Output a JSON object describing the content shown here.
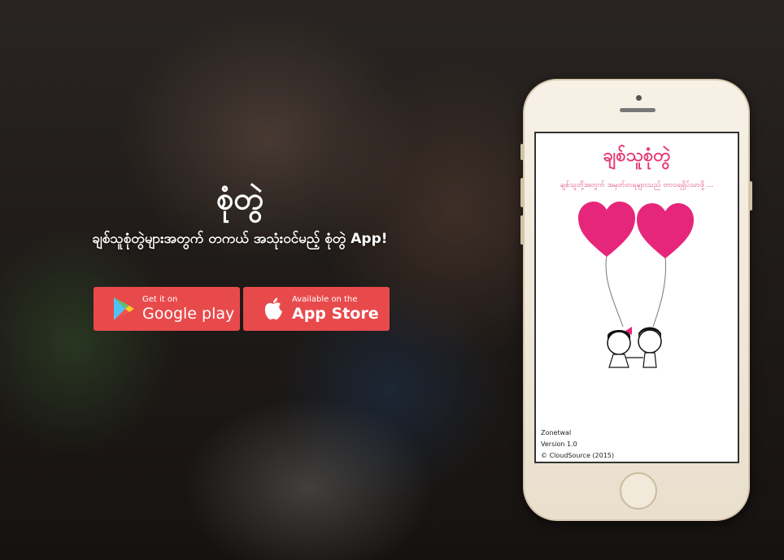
{
  "hero": {
    "title": "စုံတွဲ",
    "subtitle": "ချစ်သူစုံတွဲများအတွက် တကယ် အသုံးဝင်မည့် စုံတွဲ App!"
  },
  "store_buttons": {
    "google": {
      "small": "Get it on",
      "big": "Google play"
    },
    "apple": {
      "small": "Available on the",
      "big": "App Store"
    }
  },
  "phone_screen": {
    "app_title": "ချစ်သူစုံတွဲ",
    "tagline": "ချစ်သူတို့အတွက် အမှတ်တရများသည် တာဝရရှိပ်သာဖို့ ...",
    "app_name": "Zonetwal",
    "version": "Version 1.0",
    "copyright": "© CloudSource (2015)"
  },
  "colors": {
    "button_red": "#e84a4c",
    "heart_pink": "#e6267a",
    "app_title_pink": "#e43a75"
  }
}
